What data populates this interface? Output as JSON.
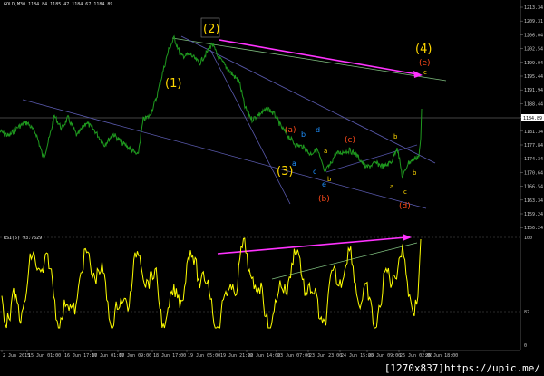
{
  "header": {
    "symbol_text": "GOLD,M30  1184.84 1185.47 1184.67 1184.89"
  },
  "rsi": {
    "label_text": "RSI(5) 93.7629",
    "levels": [
      "100",
      "82",
      "0"
    ]
  },
  "price_axis": {
    "ticks": [
      "1213.34",
      "1209.31",
      "1206.04",
      "1202.54",
      "1199.04",
      "1195.44",
      "1191.94",
      "1188.44",
      "1184.89",
      "1181.34",
      "1177.84",
      "1174.34",
      "1170.64",
      "1166.54",
      "1163.34",
      "1159.24",
      "1156.24"
    ],
    "current_price": "1184.89"
  },
  "time_axis": {
    "ticks": [
      "2 Jun 2015",
      "15 Jun 01:00",
      "16 Jun 17:00",
      "17 Jun 01:00",
      "17 Jun 09:00",
      "18 Jun 17:00",
      "19 Jun 05:00",
      "19 Jun 21:00",
      "22 Jun 14:00",
      "23 Jun 07:00",
      "23 Jun 23:00",
      "24 Jun 15:00",
      "25 Jun 09:00",
      "26 Jun 02:00",
      "26 Jun 18:00"
    ]
  },
  "wave_labels": {
    "w1": "(1)",
    "w2": "(2)",
    "w3": "(3)",
    "w4": "(4)",
    "a_paren": "(a)",
    "b_paren": "(b)",
    "c_paren": "(c)",
    "d_paren": "(d)",
    "e_paren": "(e)",
    "sub": [
      "b",
      "d",
      "a",
      "c",
      "e",
      "b",
      "a",
      "b",
      "a",
      "c",
      "b",
      "c"
    ]
  },
  "colors": {
    "background": "#000000",
    "price_line": "#1f9a1f",
    "rsi_line": "#ffff00",
    "trendline": "#7a78c8",
    "divergence": "#ff33ff",
    "wave_yellow": "#ffd700",
    "wave_red": "#ff4a1a",
    "wave_blue": "#1e90ff",
    "axis_text": "#c8c8c8"
  },
  "watermark": "[1270x837]https://upic.me/"
}
